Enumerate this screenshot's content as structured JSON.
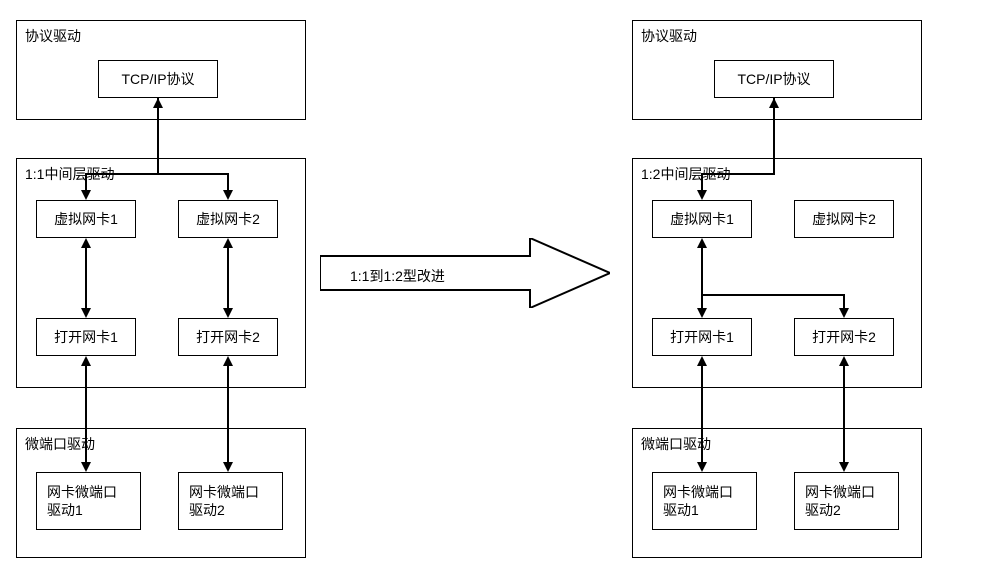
{
  "left": {
    "protocol_driver_label": "协议驱动",
    "tcp_ip": "TCP/IP协议",
    "middle_driver_label": "1:1中间层驱动",
    "virtual_card_1": "虚拟网卡1",
    "virtual_card_2": "虚拟网卡2",
    "open_card_1": "打开网卡1",
    "open_card_2": "打开网卡2",
    "miniport_driver_label": "微端口驱动",
    "miniport_1_line1": "网卡微端口",
    "miniport_1_line2": "驱动1",
    "miniport_2_line1": "网卡微端口",
    "miniport_2_line2": "驱动2"
  },
  "center": {
    "arrow_label": "1:1到1:2型改进"
  },
  "right": {
    "protocol_driver_label": "协议驱动",
    "tcp_ip": "TCP/IP协议",
    "middle_driver_label": "1:2中间层驱动",
    "virtual_card_1": "虚拟网卡1",
    "virtual_card_2": "虚拟网卡2",
    "open_card_1": "打开网卡1",
    "open_card_2": "打开网卡2",
    "miniport_driver_label": "微端口驱动",
    "miniport_1_line1": "网卡微端口",
    "miniport_1_line2": "驱动1",
    "miniport_2_line1": "网卡微端口",
    "miniport_2_line2": "驱动2"
  }
}
